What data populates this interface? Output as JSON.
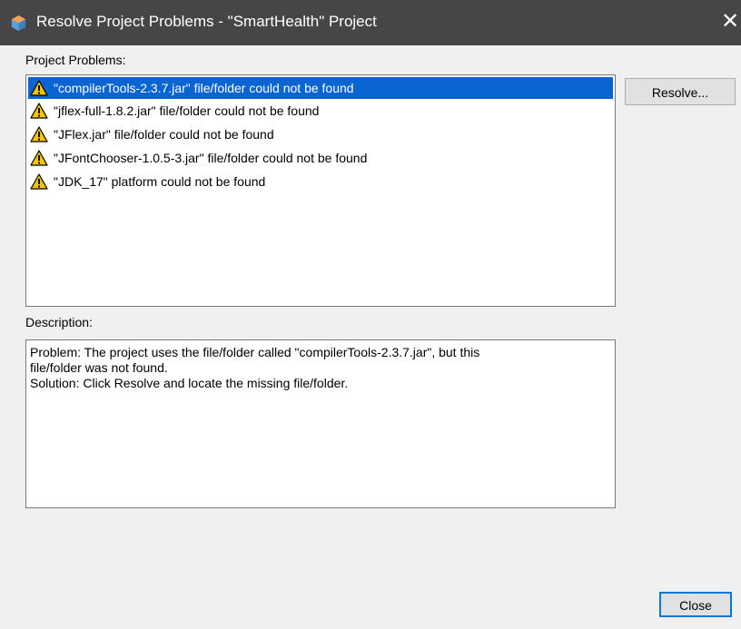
{
  "window": {
    "title": "Resolve Project Problems - \"SmartHealth\" Project",
    "close_glyph": "✕"
  },
  "problems": {
    "label": "Project Problems:",
    "icon": "warning-icon",
    "items": [
      {
        "text": "\"compilerTools-2.3.7.jar\" file/folder could not be found",
        "selected": true
      },
      {
        "text": "\"jflex-full-1.8.2.jar\" file/folder could not be found",
        "selected": false
      },
      {
        "text": "\"JFlex.jar\" file/folder could not be found",
        "selected": false
      },
      {
        "text": "\"JFontChooser-1.0.5-3.jar\" file/folder could not be found",
        "selected": false
      },
      {
        "text": "\"JDK_17\" platform could not be found",
        "selected": false
      }
    ]
  },
  "description": {
    "label": "Description:",
    "lines": [
      "Problem: The project uses the file/folder called \"compilerTools-2.3.7.jar\", but this",
      "file/folder was not found.",
      "Solution: Click Resolve and locate the missing file/folder."
    ]
  },
  "buttons": {
    "resolve_label": "Resolve...",
    "close_label": "Close"
  },
  "colors": {
    "titlebar": "#464646",
    "selection": "#0a64d2",
    "warning_fill": "#f5c400"
  }
}
